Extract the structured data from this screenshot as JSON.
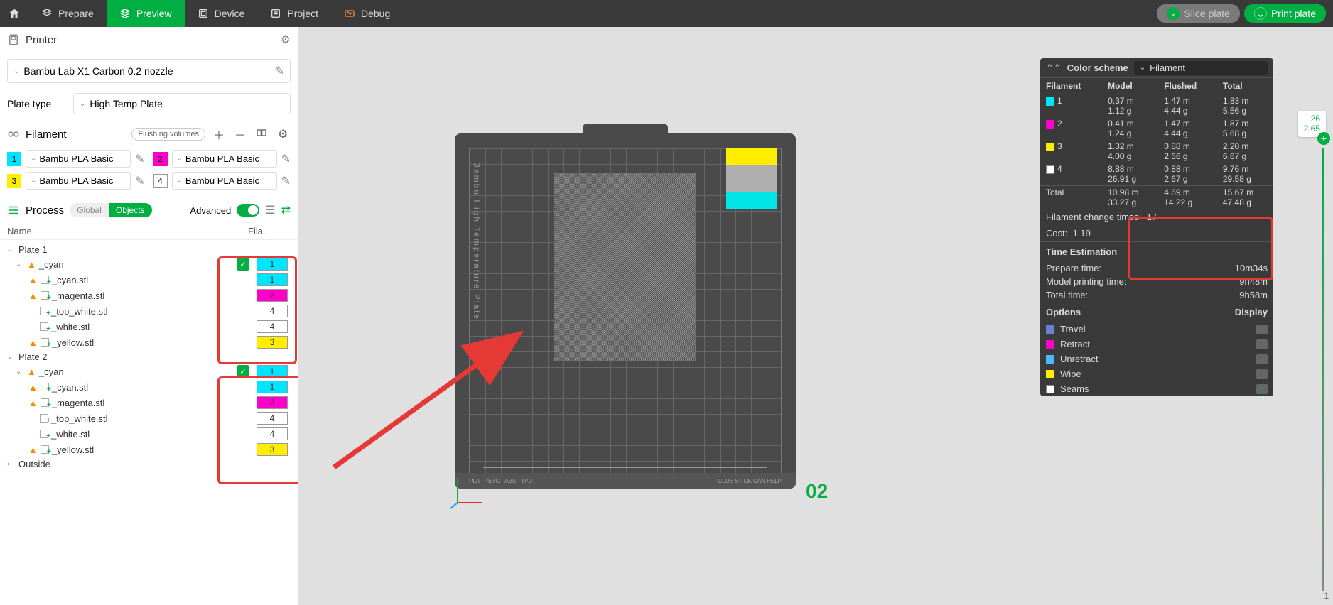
{
  "topbar": {
    "tabs": [
      "Prepare",
      "Preview",
      "Device",
      "Project",
      "Debug"
    ],
    "active": 1,
    "slice_label": "Slice plate",
    "print_label": "Print plate"
  },
  "printer": {
    "section": "Printer",
    "name": "Bambu Lab X1 Carbon 0.2 nozzle",
    "plate_type_label": "Plate type",
    "plate_type": "High Temp Plate"
  },
  "filament": {
    "section": "Filament",
    "flushing_label": "Flushing volumes",
    "items": [
      {
        "num": "1",
        "color": "#00e5ff",
        "name": "Bambu PLA Basic"
      },
      {
        "num": "2",
        "color": "#ff00c8",
        "name": "Bambu PLA Basic"
      },
      {
        "num": "3",
        "color": "#ffee00",
        "name": "Bambu PLA Basic"
      },
      {
        "num": "4",
        "color": "#ffffff",
        "border": "#999",
        "name": "Bambu PLA Basic"
      }
    ]
  },
  "process": {
    "section": "Process",
    "global_label": "Global",
    "objects_label": "Objects",
    "advanced_label": "Advanced"
  },
  "tree": {
    "name_header": "Name",
    "fila_header": "Fila.",
    "plates": [
      {
        "label": "Plate 1",
        "group": "_cyan",
        "group_fil": {
          "num": "1",
          "color": "#00e5ff"
        },
        "children": [
          {
            "name": "_cyan.stl",
            "fil": {
              "num": "1",
              "color": "#00e5ff"
            },
            "warn": true
          },
          {
            "name": "_magenta.stl",
            "fil": {
              "num": "2",
              "color": "#ff00c8"
            },
            "warn": true
          },
          {
            "name": "_top_white.stl",
            "fil": {
              "num": "4",
              "color": "#ffffff"
            },
            "warn": false
          },
          {
            "name": "_white.stl",
            "fil": {
              "num": "4",
              "color": "#ffffff"
            },
            "warn": false
          },
          {
            "name": "_yellow.stl",
            "fil": {
              "num": "3",
              "color": "#ffee00"
            },
            "warn": true
          }
        ]
      },
      {
        "label": "Plate 2",
        "group": "_cyan",
        "group_fil": {
          "num": "1",
          "color": "#00e5ff"
        },
        "children": [
          {
            "name": "_cyan.stl",
            "fil": {
              "num": "1",
              "color": "#00e5ff"
            },
            "warn": true
          },
          {
            "name": "_magenta.stl",
            "fil": {
              "num": "2",
              "color": "#ff00c8"
            },
            "warn": true
          },
          {
            "name": "_top_white.stl",
            "fil": {
              "num": "4",
              "color": "#ffffff"
            },
            "warn": false
          },
          {
            "name": "_white.stl",
            "fil": {
              "num": "4",
              "color": "#ffffff"
            },
            "warn": false
          },
          {
            "name": "_yellow.stl",
            "fil": {
              "num": "3",
              "color": "#ffee00"
            },
            "warn": true
          }
        ]
      }
    ],
    "outside_label": "Outside"
  },
  "color_scheme": {
    "title": "Color scheme",
    "mode": "Filament",
    "headers": [
      "Filament",
      "Model",
      "Flushed",
      "Total"
    ],
    "rows": [
      {
        "sw": "#00e5ff",
        "num": "1",
        "model": [
          "0.37 m",
          "1.12 g"
        ],
        "flushed": [
          "1.47 m",
          "4.44 g"
        ],
        "total": [
          "1.83 m",
          "5.56 g"
        ]
      },
      {
        "sw": "#ff00c8",
        "num": "2",
        "model": [
          "0.41 m",
          "1.24 g"
        ],
        "flushed": [
          "1.47 m",
          "4.44 g"
        ],
        "total": [
          "1.87 m",
          "5.68 g"
        ]
      },
      {
        "sw": "#ffee00",
        "num": "3",
        "model": [
          "1.32 m",
          "4.00 g"
        ],
        "flushed": [
          "0.88 m",
          "2.66 g"
        ],
        "total": [
          "2.20 m",
          "6.67 g"
        ]
      },
      {
        "sw": "#ffffff",
        "num": "4",
        "model": [
          "8.88 m",
          "26.91 g"
        ],
        "flushed": [
          "0.88 m",
          "2.67 g"
        ],
        "total": [
          "9.76 m",
          "29.58 g"
        ]
      }
    ],
    "total_row": {
      "label": "Total",
      "model": [
        "10.98 m",
        "33.27 g"
      ],
      "flushed": [
        "4.69 m",
        "14.22 g"
      ],
      "total": [
        "15.67 m",
        "47.48 g"
      ]
    },
    "change_times_label": "Filament change times:",
    "change_times": "17",
    "cost_label": "Cost:",
    "cost": "1.19",
    "time_title": "Time Estimation",
    "prepare_label": "Prepare time:",
    "prepare": "10m34s",
    "model_time_label": "Model printing time:",
    "model_time": "9h48m",
    "total_time_label": "Total time:",
    "total_time": "9h58m",
    "options_title": "Options",
    "display_title": "Display",
    "options": [
      {
        "sw": "#6b7fd7",
        "label": "Travel",
        "on": false
      },
      {
        "sw": "#ff00c8",
        "label": "Retract",
        "on": false
      },
      {
        "sw": "#4db8ff",
        "label": "Unretract",
        "on": false
      },
      {
        "sw": "#ffee00",
        "label": "Wipe",
        "on": false
      },
      {
        "sw": "#ffffff",
        "label": "Seams",
        "on": true
      }
    ]
  },
  "viewport": {
    "plate_label": "Bambu High Temperature Plate",
    "plate_num": "02",
    "slider_top": "26",
    "slider_bot": "2.65"
  },
  "purge_colors": [
    "#ffee00",
    "#ffee00",
    "#b0b0b0",
    "#b0b0b0",
    "#b0b0b0",
    "#00e5e5",
    "#00e5e5"
  ]
}
